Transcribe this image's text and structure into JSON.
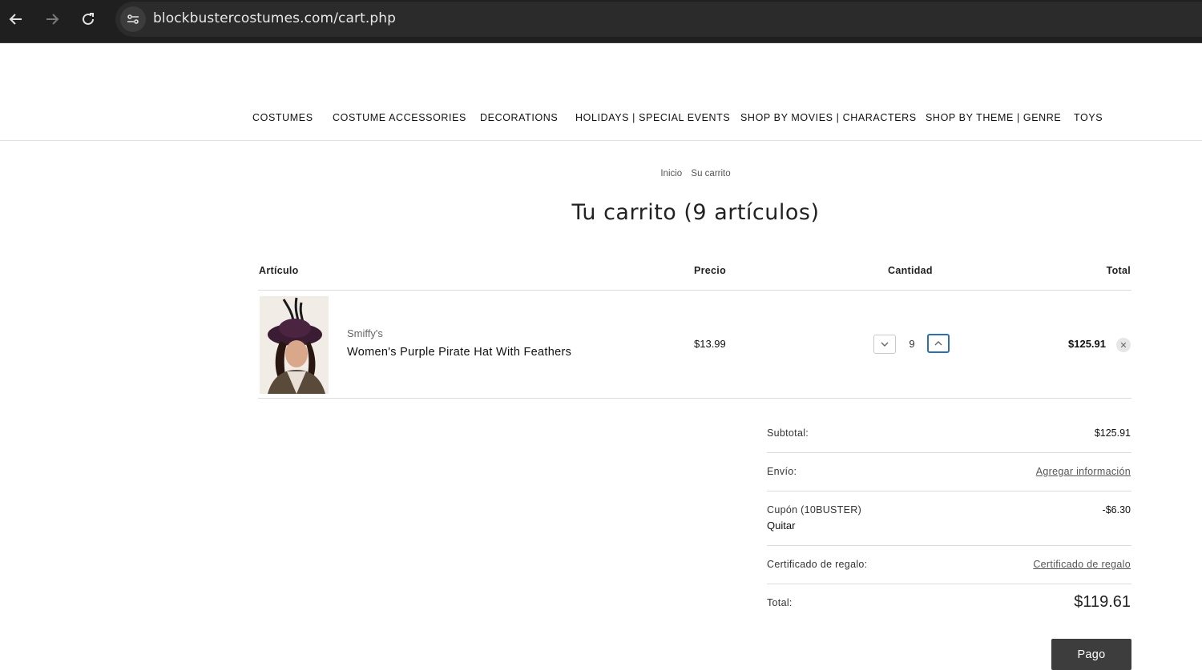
{
  "browser": {
    "url": "blockbustercostumes.com/cart.php",
    "back_icon": "arrow-left-icon",
    "forward_icon": "arrow-right-icon",
    "reload_icon": "reload-icon",
    "site_info_icon": "tune-icon"
  },
  "nav": {
    "items": [
      "COSTUMES",
      "COSTUME ACCESSORIES",
      "DECORATIONS",
      "HOLIDAYS | SPECIAL EVENTS",
      "SHOP BY MOVIES | CHARACTERS",
      "SHOP BY THEME | GENRE",
      "TOYS"
    ]
  },
  "breadcrumb": {
    "home": "Inicio",
    "current": "Su carrito"
  },
  "page_title": "Tu carrito (9 artículos)",
  "table": {
    "headers": {
      "item": "Artículo",
      "price": "Precio",
      "quantity": "Cantidad",
      "total": "Total"
    },
    "rows": [
      {
        "brand": "Smiffy's",
        "name": "Women's Purple Pirate Hat With Feathers",
        "price": "$13.99",
        "quantity": "9",
        "total": "$125.91"
      }
    ]
  },
  "totals": {
    "subtotal_label": "Subtotal:",
    "subtotal_value": "$125.91",
    "shipping_label": "Envío:",
    "shipping_link": "Agregar información",
    "coupon_label": "Cupón (10BUSTER)",
    "coupon_value": "-$6.30",
    "coupon_remove": "Quitar",
    "gift_label": "Certificado de regalo:",
    "gift_link": "Certificado de regalo",
    "total_label": "Total:",
    "total_value": "$119.61"
  },
  "checkout_button": "Pago",
  "colors": {
    "chrome_bg": "#1f1f1f",
    "button_bg": "#3d3d3d",
    "focus": "#2e6fb0"
  }
}
